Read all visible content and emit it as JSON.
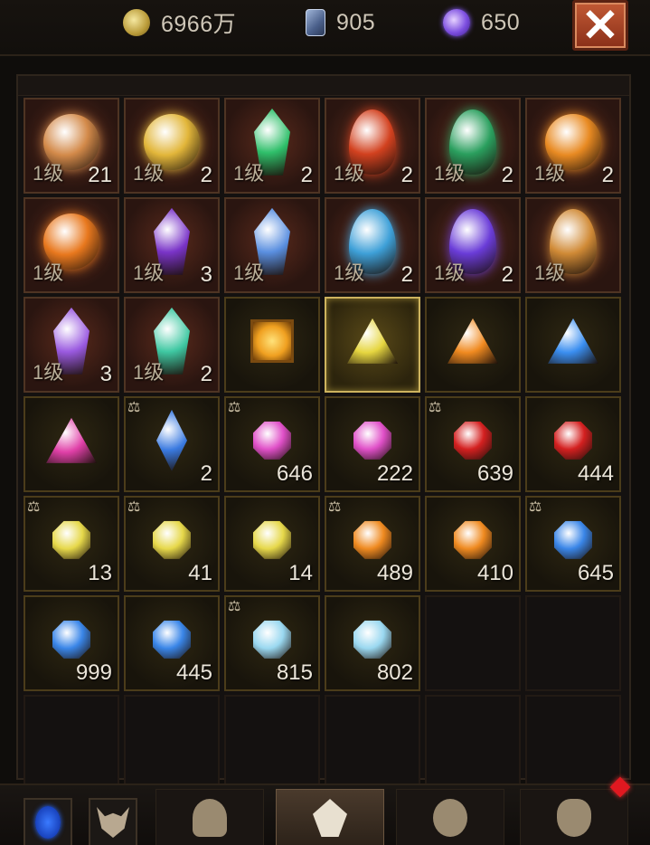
{
  "currencies": [
    {
      "icon": "gold-coin-icon",
      "value": "6966万"
    },
    {
      "icon": "card-icon",
      "value": "905"
    },
    {
      "icon": "purple-orb-icon",
      "value": "650"
    }
  ],
  "close_label": "✕",
  "inventory": [
    {
      "name": "bronze-orb-charm",
      "type": "eq",
      "shape": "orb",
      "color": "#d38a4a",
      "level": "1级",
      "count": "21"
    },
    {
      "name": "golden-caged-orb",
      "type": "eq",
      "shape": "orb",
      "color": "#e2b63a",
      "level": "1级",
      "count": "2"
    },
    {
      "name": "green-crystal-crest",
      "type": "eq",
      "shape": "shard",
      "color": "#2fbf6a",
      "level": "1级",
      "count": "2"
    },
    {
      "name": "lava-stone",
      "type": "eq",
      "shape": "egg",
      "color": "#d2411f",
      "level": "1级",
      "count": "2"
    },
    {
      "name": "green-egg-stone",
      "type": "eq",
      "shape": "egg",
      "color": "#2a9f5e",
      "level": "1级",
      "count": "2"
    },
    {
      "name": "amber-orb",
      "type": "eq",
      "shape": "orb",
      "color": "#e88a22",
      "level": "1级",
      "count": "2"
    },
    {
      "name": "magma-orb",
      "type": "eq",
      "shape": "orb",
      "color": "#e8781e",
      "level": "1级",
      "count": ""
    },
    {
      "name": "purple-shard",
      "type": "eq",
      "shape": "shard",
      "color": "#7a34c8",
      "level": "1级",
      "count": "3"
    },
    {
      "name": "blue-crystal",
      "type": "eq",
      "shape": "shard",
      "color": "#5a8fe0",
      "level": "1级",
      "count": ""
    },
    {
      "name": "azure-stone",
      "type": "eq",
      "shape": "egg",
      "color": "#3ea0d8",
      "level": "1级",
      "count": "2"
    },
    {
      "name": "violet-crystal",
      "type": "eq",
      "shape": "egg",
      "color": "#6a3cd8",
      "level": "1级",
      "count": "2"
    },
    {
      "name": "amber-rune-stone",
      "type": "eq",
      "shape": "egg",
      "color": "#d08a36",
      "level": "1级",
      "count": ""
    },
    {
      "name": "amethyst-shard",
      "type": "eq",
      "shape": "shard",
      "color": "#9a5ae0",
      "level": "1级",
      "count": "3"
    },
    {
      "name": "teal-shard",
      "type": "eq",
      "shape": "shard",
      "color": "#3fc8a2",
      "level": "1级",
      "count": "2"
    },
    {
      "name": "square-topaz",
      "type": "gem",
      "shape": "sq",
      "color": "#f0a020",
      "level": "",
      "count": ""
    },
    {
      "name": "yellow-trillion",
      "type": "sel",
      "shape": "tri",
      "color": "#e6d640",
      "level": "",
      "count": ""
    },
    {
      "name": "orange-trillion",
      "type": "gem",
      "shape": "tri",
      "color": "#f08a20",
      "level": "",
      "count": ""
    },
    {
      "name": "blue-trillion",
      "type": "gem",
      "shape": "tri",
      "color": "#3a8ef0",
      "level": "",
      "count": ""
    },
    {
      "name": "pink-trillion",
      "type": "gem",
      "shape": "tri",
      "color": "#e040a8",
      "level": "",
      "count": "",
      "scale": false
    },
    {
      "name": "blue-marquise",
      "type": "gem",
      "shape": "marq",
      "color": "#3a7ae0",
      "level": "",
      "count": "2",
      "scale": true
    },
    {
      "name": "pink-gem",
      "type": "gem",
      "shape": "rnd",
      "color": "#e050c8",
      "level": "",
      "count": "646",
      "scale": true
    },
    {
      "name": "pink-gem",
      "type": "gem",
      "shape": "rnd",
      "color": "#e050c8",
      "level": "",
      "count": "222",
      "scale": false
    },
    {
      "name": "red-gem",
      "type": "gem",
      "shape": "rnd",
      "color": "#d42020",
      "level": "",
      "count": "639",
      "scale": true
    },
    {
      "name": "red-gem",
      "type": "gem",
      "shape": "rnd",
      "color": "#d42020",
      "level": "",
      "count": "444",
      "scale": false
    },
    {
      "name": "yellow-gem",
      "type": "gem",
      "shape": "rnd",
      "color": "#e6d84a",
      "level": "",
      "count": "13",
      "scale": true
    },
    {
      "name": "yellow-gem",
      "type": "gem",
      "shape": "rnd",
      "color": "#e6d84a",
      "level": "",
      "count": "41",
      "scale": true
    },
    {
      "name": "yellow-gem",
      "type": "gem",
      "shape": "rnd",
      "color": "#e6d84a",
      "level": "",
      "count": "14",
      "scale": false
    },
    {
      "name": "orange-gem",
      "type": "gem",
      "shape": "rnd",
      "color": "#ef8a20",
      "level": "",
      "count": "489",
      "scale": true
    },
    {
      "name": "orange-gem",
      "type": "gem",
      "shape": "rnd",
      "color": "#ef8a20",
      "level": "",
      "count": "410",
      "scale": false
    },
    {
      "name": "blue-gem",
      "type": "gem",
      "shape": "rnd",
      "color": "#3a86e8",
      "level": "",
      "count": "645",
      "scale": true
    },
    {
      "name": "blue-gem",
      "type": "gem",
      "shape": "rnd",
      "color": "#3a86e8",
      "level": "",
      "count": "999",
      "scale": false
    },
    {
      "name": "blue-gem",
      "type": "gem",
      "shape": "rnd",
      "color": "#3a86e8",
      "level": "",
      "count": "445",
      "scale": false
    },
    {
      "name": "cyan-gem",
      "type": "gem",
      "shape": "rnd",
      "color": "#9ad8f0",
      "level": "",
      "count": "815",
      "scale": true
    },
    {
      "name": "cyan-gem",
      "type": "gem",
      "shape": "rnd",
      "color": "#9ad8f0",
      "level": "",
      "count": "802",
      "scale": false
    },
    {
      "name": "empty",
      "type": "empty"
    },
    {
      "name": "empty",
      "type": "empty"
    },
    {
      "name": "empty",
      "type": "empty"
    },
    {
      "name": "empty",
      "type": "empty"
    },
    {
      "name": "empty",
      "type": "empty"
    },
    {
      "name": "empty",
      "type": "empty"
    },
    {
      "name": "empty",
      "type": "empty"
    },
    {
      "name": "empty",
      "type": "empty"
    }
  ],
  "bottom_nav": [
    {
      "icon": "blue-portal-icon"
    },
    {
      "icon": "demon-mask-icon"
    },
    {
      "icon": "helmet-tab-icon"
    },
    {
      "icon": "gem-tab-icon",
      "active": true
    },
    {
      "icon": "rune-tab-icon"
    },
    {
      "icon": "bag-tab-icon"
    }
  ],
  "scale_glyph": "⚖"
}
